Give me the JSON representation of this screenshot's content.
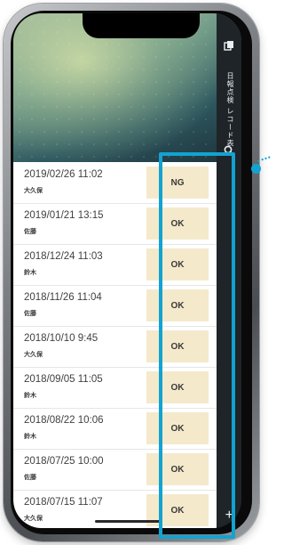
{
  "app": {
    "vertical_label": "日報点検 レコード表"
  },
  "records": [
    {
      "datetime": "2019/02/26 11:02",
      "name": "大久保",
      "result": "NG"
    },
    {
      "datetime": "2019/01/21 13:15",
      "name": "佐藤",
      "result": "OK"
    },
    {
      "datetime": "2018/12/24 11:03",
      "name": "鈴木",
      "result": "OK"
    },
    {
      "datetime": "2018/11/26 11:04",
      "name": "佐藤",
      "result": "OK"
    },
    {
      "datetime": "2018/10/10 9:45",
      "name": "大久保",
      "result": "OK"
    },
    {
      "datetime": "2018/09/05 11:05",
      "name": "鈴木",
      "result": "OK"
    },
    {
      "datetime": "2018/08/22 10:06",
      "name": "鈴木",
      "result": "OK"
    },
    {
      "datetime": "2018/07/25 10:00",
      "name": "佐藤",
      "result": "OK"
    },
    {
      "datetime": "2018/07/15 11:07",
      "name": "大久保",
      "result": "OK"
    }
  ],
  "icons": {
    "copy": "copy-icon",
    "search": "search-icon",
    "add": "plus-icon"
  },
  "colors": {
    "highlight": "#12a3d0",
    "badge_bg": "#f4e9cb"
  }
}
